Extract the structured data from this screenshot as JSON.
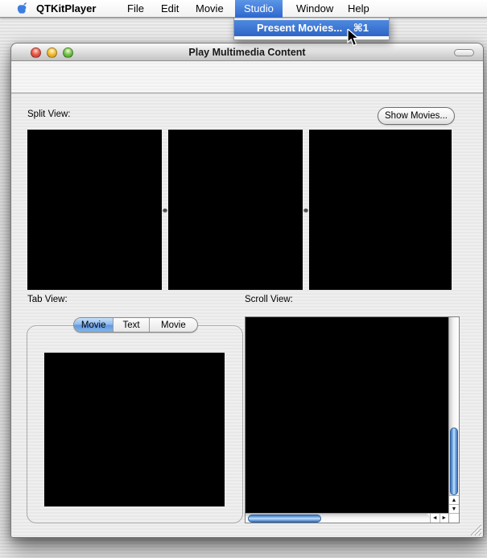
{
  "menu_bar": {
    "items": [
      {
        "label": "QTKitPlayer"
      },
      {
        "label": "File"
      },
      {
        "label": "Edit"
      },
      {
        "label": "Movie"
      },
      {
        "label": "Studio",
        "highlighted": true
      },
      {
        "label": "Window"
      },
      {
        "label": "Help"
      }
    ]
  },
  "studio_menu": {
    "present_movies_label": "Present Movies...",
    "present_movies_shortcut": "⌘1"
  },
  "window": {
    "title": "Play Multimedia Content",
    "split_view_label": "Split View:",
    "tab_view_label": "Tab View:",
    "scroll_view_label": "Scroll View:",
    "show_movies_button": "Show Movies...",
    "tabs": [
      {
        "label": "Movie",
        "selected": true
      },
      {
        "label": "Text",
        "selected": false
      },
      {
        "label": "Movie",
        "selected": false
      }
    ]
  },
  "icons": {
    "up_arrow": "▲",
    "down_arrow": "▼",
    "left_arrow": "◄",
    "right_arrow": "►"
  },
  "colors": {
    "menu_highlight": "#3b77d8",
    "aqua_scrollbar_thumb": "#5a94d6",
    "apple_logo_blue": "#3e7de0",
    "selected_tab_blue": "#7fb0e8",
    "movie_view_black": "#000000"
  }
}
